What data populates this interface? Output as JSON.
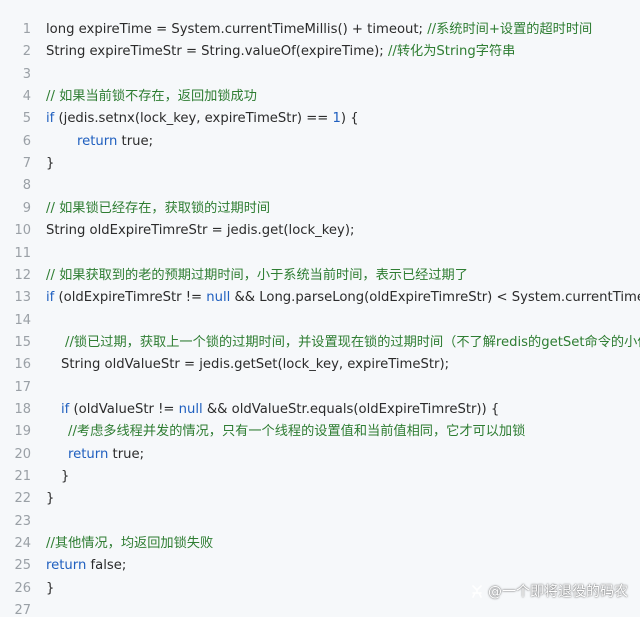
{
  "colors": {
    "background": "#f6f8fa",
    "text": "#2b2b2b",
    "keyword": "#1f5fbf",
    "comment": "#2e7d32",
    "line_number": "#9aa0a6"
  },
  "watermark": {
    "text": "@一个即将退役的码农",
    "icon": "platform-logo-icon"
  },
  "lines": [
    {
      "num": "1",
      "indent": 0,
      "tokens": [
        {
          "t": "p",
          "v": "long expireTime = System.currentTimeMillis() + timeout; "
        },
        {
          "t": "c",
          "v": "//系统时间+设置的超时时间"
        }
      ]
    },
    {
      "num": "2",
      "indent": 0,
      "tokens": [
        {
          "t": "p",
          "v": "String expireTimeStr = String.valueOf(expireTime); "
        },
        {
          "t": "c",
          "v": "//转化为String字符串"
        }
      ]
    },
    {
      "num": "3",
      "indent": 0,
      "tokens": []
    },
    {
      "num": "4",
      "indent": 0,
      "tokens": [
        {
          "t": "c",
          "v": "// 如果当前锁不存在，返回加锁成功"
        }
      ]
    },
    {
      "num": "5",
      "indent": 0,
      "tokens": [
        {
          "t": "k",
          "v": "if"
        },
        {
          "t": "p",
          "v": " (jedis.setnx(lock_key, expireTimeStr) == "
        },
        {
          "t": "n",
          "v": "1"
        },
        {
          "t": "p",
          "v": ") {"
        }
      ]
    },
    {
      "num": "6",
      "indent": 31,
      "tokens": [
        {
          "t": "k",
          "v": "return"
        },
        {
          "t": "p",
          "v": " true;"
        }
      ]
    },
    {
      "num": "7",
      "indent": 0,
      "tokens": [
        {
          "t": "p",
          "v": "}"
        }
      ]
    },
    {
      "num": "8",
      "indent": 0,
      "tokens": []
    },
    {
      "num": "9",
      "indent": 0,
      "tokens": [
        {
          "t": "c",
          "v": "// 如果锁已经存在，获取锁的过期时间"
        }
      ]
    },
    {
      "num": "10",
      "indent": 0,
      "tokens": [
        {
          "t": "p",
          "v": "String oldExpireTimreStr = jedis.get(lock_key);"
        }
      ]
    },
    {
      "num": "11",
      "indent": 0,
      "tokens": []
    },
    {
      "num": "12",
      "indent": 0,
      "tokens": [
        {
          "t": "c",
          "v": "// 如果获取到的老的预期过期时间，小于系统当前时间，表示已经过期了"
        }
      ]
    },
    {
      "num": "13",
      "indent": 0,
      "tokens": [
        {
          "t": "k",
          "v": "if"
        },
        {
          "t": "p",
          "v": " (oldExpireTimreStr != "
        },
        {
          "t": "k",
          "v": "null"
        },
        {
          "t": "p",
          "v": " && Long.parseLong(oldExpireTimreStr) < System.currentTimeMillis()"
        }
      ]
    },
    {
      "num": "14",
      "indent": 0,
      "tokens": []
    },
    {
      "num": "15",
      "indent": 19,
      "tokens": [
        {
          "t": "c",
          "v": "//锁已过期，获取上一个锁的过期时间，并设置现在锁的过期时间（不了解redis的getSet命令的小伙伴"
        }
      ]
    },
    {
      "num": "16",
      "indent": 15,
      "tokens": [
        {
          "t": "p",
          "v": "String oldValueStr = jedis.getSet(lock_key, expireTimeStr);"
        }
      ]
    },
    {
      "num": "17",
      "indent": 0,
      "tokens": []
    },
    {
      "num": "18",
      "indent": 15,
      "tokens": [
        {
          "t": "k",
          "v": "if"
        },
        {
          "t": "p",
          "v": " (oldValueStr != "
        },
        {
          "t": "k",
          "v": "null"
        },
        {
          "t": "p",
          "v": " && oldValueStr.equals(oldExpireTimreStr)) {"
        }
      ]
    },
    {
      "num": "19",
      "indent": 22,
      "tokens": [
        {
          "t": "c",
          "v": "//考虑多线程并发的情况，只有一个线程的设置值和当前值相同，它才可以加锁"
        }
      ]
    },
    {
      "num": "20",
      "indent": 22,
      "tokens": [
        {
          "t": "k",
          "v": "return"
        },
        {
          "t": "p",
          "v": " true;"
        }
      ]
    },
    {
      "num": "21",
      "indent": 15,
      "tokens": [
        {
          "t": "p",
          "v": "}"
        }
      ]
    },
    {
      "num": "22",
      "indent": 0,
      "tokens": [
        {
          "t": "p",
          "v": "}"
        }
      ]
    },
    {
      "num": "23",
      "indent": 0,
      "tokens": []
    },
    {
      "num": "24",
      "indent": 0,
      "tokens": [
        {
          "t": "c",
          "v": "//其他情况，均返回加锁失败"
        }
      ]
    },
    {
      "num": "25",
      "indent": 0,
      "tokens": [
        {
          "t": "k",
          "v": "return"
        },
        {
          "t": "p",
          "v": " false;"
        }
      ]
    },
    {
      "num": "26",
      "indent": 0,
      "tokens": [
        {
          "t": "p",
          "v": "}"
        }
      ]
    },
    {
      "num": "27",
      "indent": 0,
      "tokens": []
    }
  ]
}
